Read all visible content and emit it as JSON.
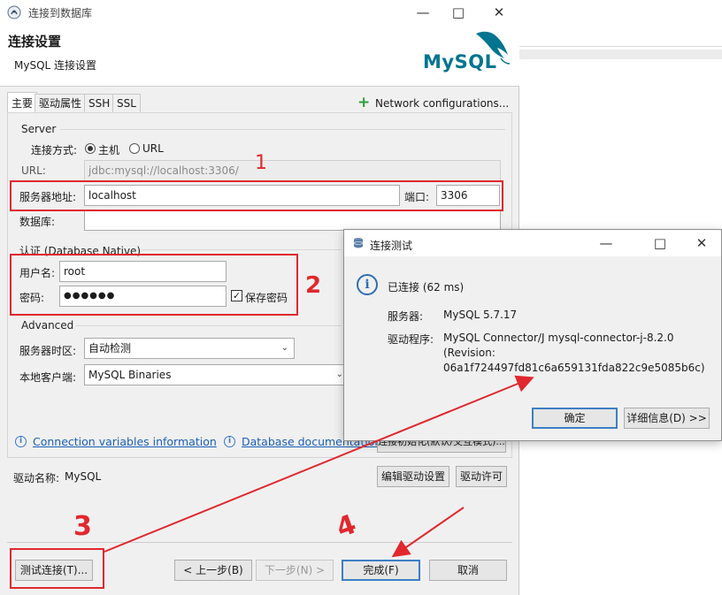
{
  "window": {
    "title": "连接到数据库"
  },
  "header": {
    "title": "连接设置",
    "subtitle": "MySQL 连接设置",
    "logo_text": "MySQL"
  },
  "tabs": [
    "主要",
    "驱动属性",
    "SSH",
    "SSL"
  ],
  "network_config": {
    "label": "Network configurations..."
  },
  "server": {
    "group_label": "Server",
    "connect_mode_label": "连接方式:",
    "mode_host": "主机",
    "mode_url": "URL",
    "url_label": "URL:",
    "url_value": "jdbc:mysql://localhost:3306/",
    "host_label": "服务器地址:",
    "host_value": "localhost",
    "port_label": "端口:",
    "port_value": "3306",
    "db_label": "数据库:",
    "db_value": ""
  },
  "auth": {
    "group_label": "认证 (Database Native)",
    "user_label": "用户名:",
    "user_value": "root",
    "password_label": "密码:",
    "password_value": "●●●●●●",
    "save_password_label": "保存密码"
  },
  "advanced": {
    "group_label": "Advanced",
    "timezone_label": "服务器时区:",
    "timezone_value": "自动检测",
    "client_label": "本地客户端:",
    "client_value": "MySQL Binaries"
  },
  "links": {
    "conn_vars": "Connection variables information",
    "db_docs": "Database documentation",
    "edit_conn": "连接初始化(默认/交互模式)..."
  },
  "driver": {
    "name_label": "驱动名称:",
    "name_value": "MySQL",
    "edit_button": "编辑驱动设置",
    "license_button": "驱动许可"
  },
  "footer": {
    "test_button": "测试连接(T)...",
    "back_button": "< 上一步(B)",
    "next_button": "下一步(N) >",
    "finish_button": "完成(F)",
    "cancel_button": "取消"
  },
  "test_dialog": {
    "title": "连接测试",
    "status": "已连接 (62 ms)",
    "server_label": "服务器:",
    "server_value": "MySQL 5.7.17",
    "driver_label": "驱动程序:",
    "driver_line1": "MySQL Connector/J mysql-connector-j-8.2.0",
    "driver_line2": "(Revision:",
    "driver_line3": "06a1f724497fd81c6a659131fda822c9e5085b6c)",
    "ok_button": "确定",
    "details_button": "详细信息(D) >>"
  },
  "annotations": [
    "1",
    "2",
    "3",
    "4"
  ],
  "colors": {
    "annotation_red": "#e0282e",
    "link_blue": "#1b5fb5",
    "mysql_blue": "#00758f",
    "mysql_orange": "#f29111",
    "add_green": "#2e9d3a"
  }
}
